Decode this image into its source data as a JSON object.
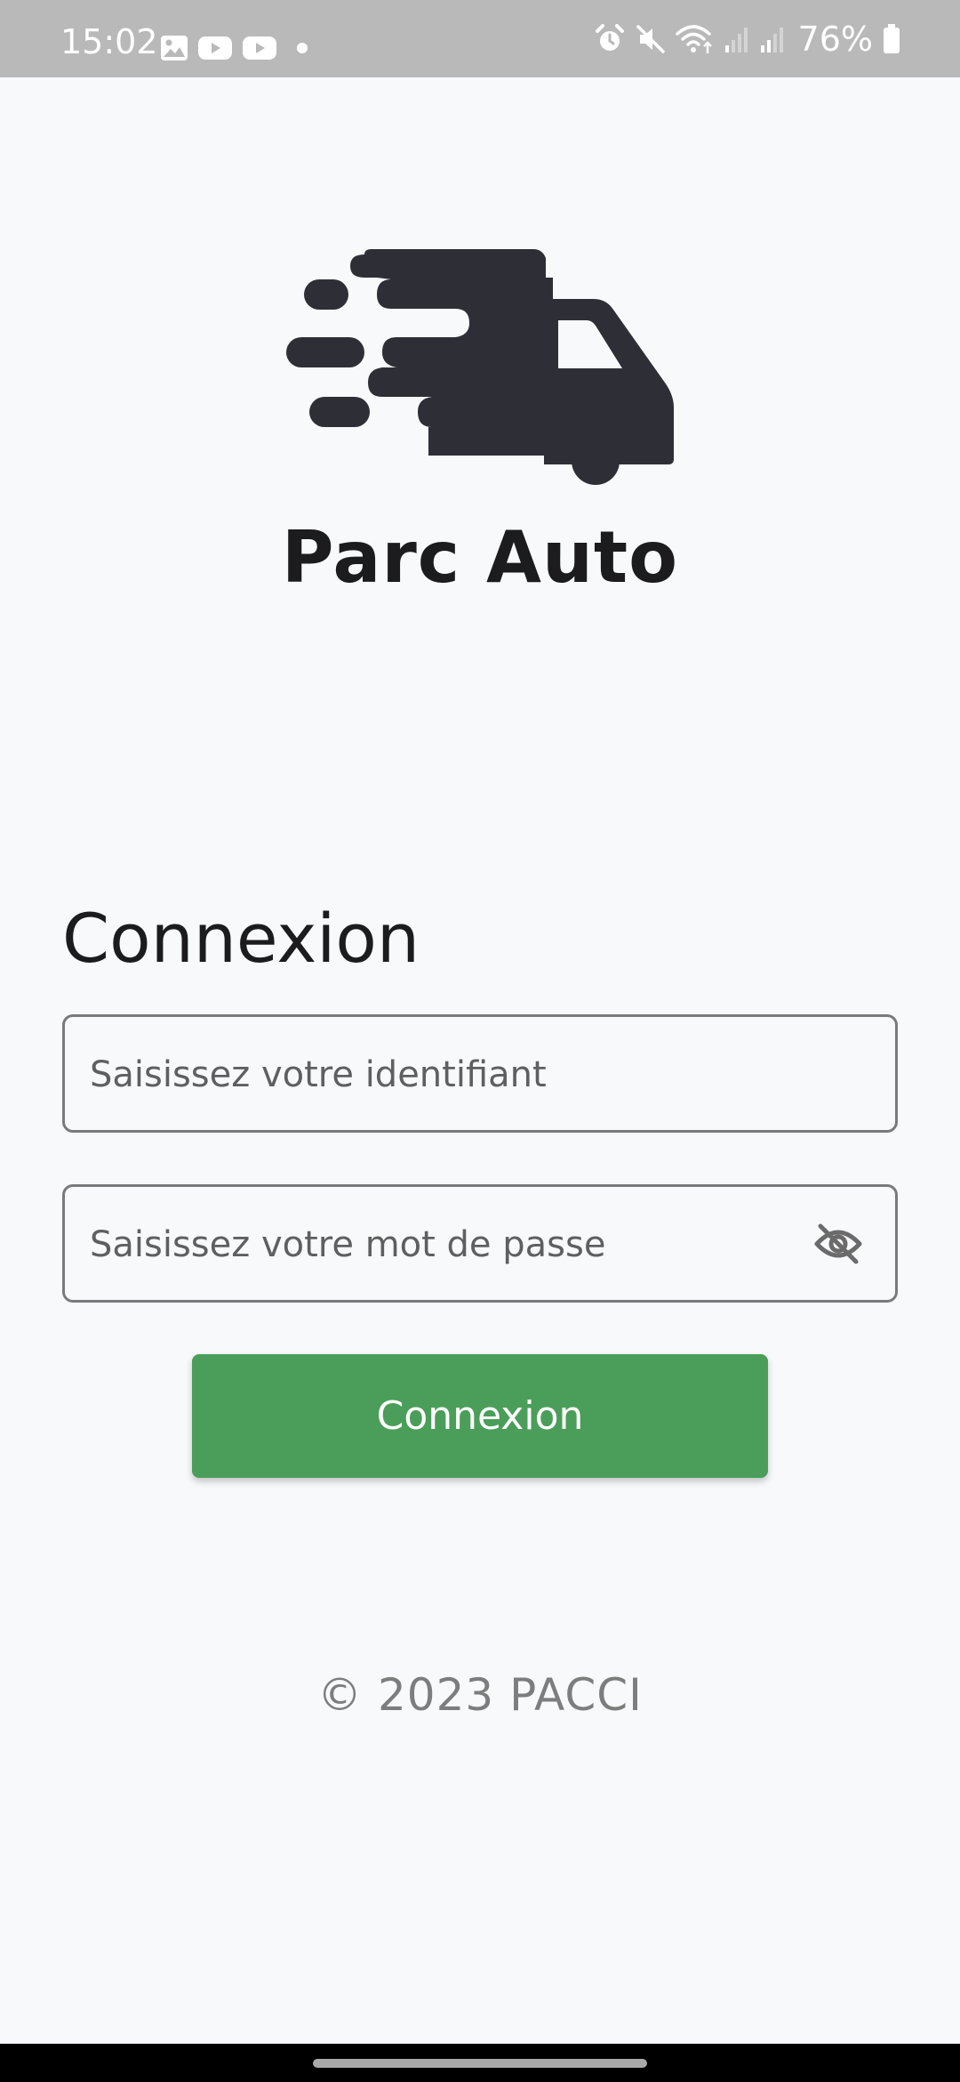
{
  "status_bar": {
    "time": "15:02",
    "battery_percent": "76%",
    "notification_icons": [
      "image-icon",
      "youtube-icon",
      "youtube-icon",
      "dot-icon"
    ],
    "system_icons": [
      "alarm-icon",
      "mute-icon",
      "wifi-icon",
      "signal-icon",
      "signal-icon",
      "battery-icon"
    ]
  },
  "app": {
    "logo_icon": "delivery-truck-icon",
    "title": "Parc Auto"
  },
  "login_form": {
    "heading": "Connexion",
    "username_placeholder": "Saisissez votre identifiant",
    "username_value": "",
    "password_placeholder": "Saisissez votre mot de passe",
    "password_value": "",
    "password_toggle_icon": "eye-off-icon",
    "submit_label": "Connexion"
  },
  "footer": {
    "copyright": "© 2023 PACCI"
  },
  "colors": {
    "background": "#f8f9fb",
    "status_bar": "#b9b9b9",
    "primary_button": "#4b9e59",
    "logo": "#2e2f36",
    "text_dark": "#1c1c1e",
    "text_muted": "#7d7d7d"
  }
}
